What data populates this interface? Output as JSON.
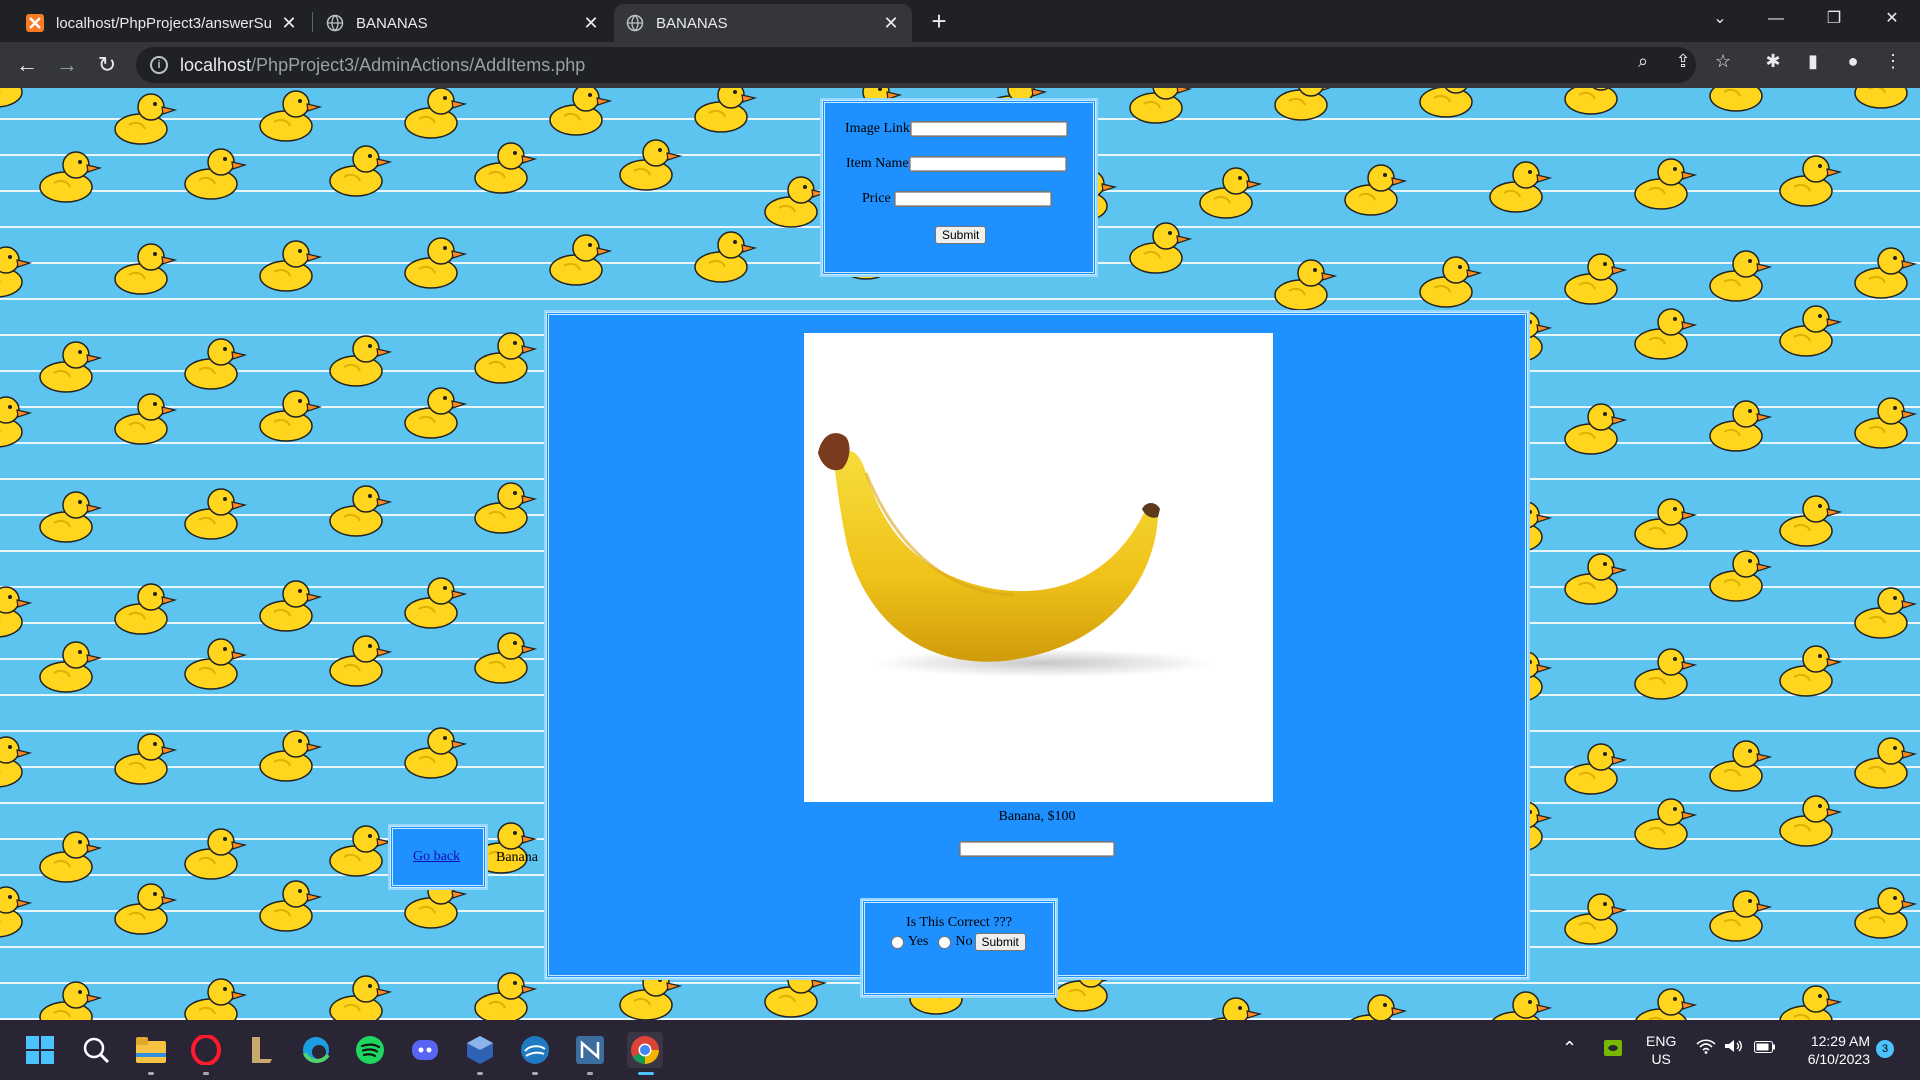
{
  "tabs": [
    {
      "title": "localhost/PhpProject3/answerSu",
      "favicon": "xampp-icon"
    },
    {
      "title": "BANANAS",
      "favicon": "globe-icon"
    },
    {
      "title": "BANANAS",
      "favicon": "globe-icon"
    }
  ],
  "address": {
    "host": "localhost",
    "path": "/PhpProject3/AdminActions/AddItems.php"
  },
  "add_form": {
    "image_link_label": "Image Link",
    "item_name_label": "Item Name",
    "price_label": "Price",
    "submit_label": "Submit"
  },
  "preview": {
    "caption": "Banana, $100",
    "image_alt": "banana-image"
  },
  "go_back_label": "Go back",
  "side_text": "Banana",
  "confirm": {
    "question": "Is This Correct ???",
    "yes_label": "Yes",
    "no_label": "No",
    "submit_label": "Submit"
  },
  "tray": {
    "lang_top": "ENG",
    "lang_bottom": "US",
    "time": "12:29 AM",
    "date": "6/10/2023",
    "notification_count": "3"
  },
  "colors": {
    "panel": "#1e90ff",
    "background": "#5cc4ef",
    "duck": "#ffd51e"
  }
}
